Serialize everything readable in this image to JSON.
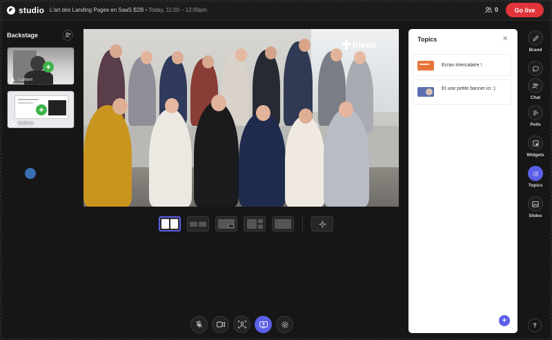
{
  "app": {
    "name": "studio"
  },
  "session": {
    "title": "L'art des Landing Pages en SaaS B2B",
    "schedule": "• Today, 11:00 – 12:00pm"
  },
  "header": {
    "viewer_count": "0",
    "golive_label": "Go live"
  },
  "backstage": {
    "title": "Backstage",
    "participants": [
      {
        "name": "Guilhem"
      },
      {
        "name": "Guilhem"
      }
    ]
  },
  "stage": {
    "brand_text": "invox"
  },
  "layouts": [
    {
      "name": "two-side-by-side",
      "active": true
    },
    {
      "name": "two-small",
      "active": false
    },
    {
      "name": "picture-in-picture",
      "active": false
    },
    {
      "name": "main-with-side",
      "active": false
    },
    {
      "name": "single",
      "active": false
    },
    {
      "name": "magic",
      "active": false
    }
  ],
  "topics": {
    "title": "Topics",
    "items": [
      {
        "text": "Ecran intercalaire !",
        "thumb_color": "#e8743a"
      },
      {
        "text": "Et une petite banner ici :)",
        "thumb_color": "#5c6fb0"
      }
    ]
  },
  "rail": [
    {
      "label": "Brand",
      "icon": "pen-icon"
    },
    {
      "label": "Chat",
      "icon": "chat-icon"
    },
    {
      "label": "Polls",
      "icon": "polls-icon"
    },
    {
      "label": "Widgets",
      "icon": "widgets-icon"
    },
    {
      "label": "Topics",
      "icon": "topics-icon",
      "active": true
    },
    {
      "label": "Slides",
      "icon": "slides-icon"
    }
  ],
  "help_label": "?",
  "colors": {
    "accent": "#5b5fe8",
    "golive": "#e0343a",
    "add": "#3cb34a"
  }
}
